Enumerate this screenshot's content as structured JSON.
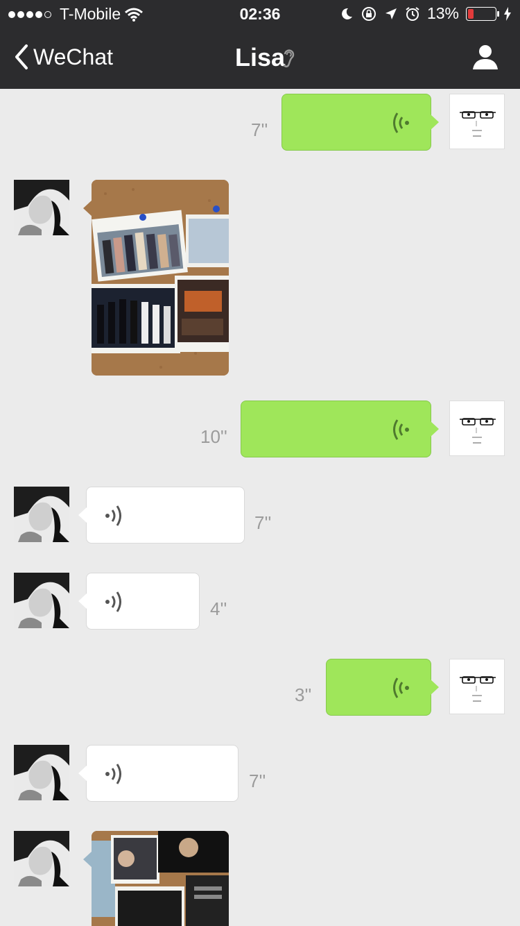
{
  "status": {
    "carrier": "T-Mobile",
    "time": "02:36",
    "battery": "13%"
  },
  "nav": {
    "back_label": "WeChat",
    "title": "Lisa"
  },
  "messages": [
    {
      "side": "right",
      "type": "voice",
      "duration": "7''"
    },
    {
      "side": "left",
      "type": "image"
    },
    {
      "side": "right",
      "type": "voice",
      "duration": "10''"
    },
    {
      "side": "left",
      "type": "voice",
      "duration": "7''"
    },
    {
      "side": "left",
      "type": "voice",
      "duration": "4''"
    },
    {
      "side": "right",
      "type": "voice",
      "duration": "3''"
    },
    {
      "side": "left",
      "type": "voice",
      "duration": "7''"
    },
    {
      "side": "left",
      "type": "image"
    }
  ],
  "colors": {
    "sent_bubble": "#9fe65a",
    "received_bubble": "#ffffff",
    "nav_bg": "#2c2c2e"
  }
}
